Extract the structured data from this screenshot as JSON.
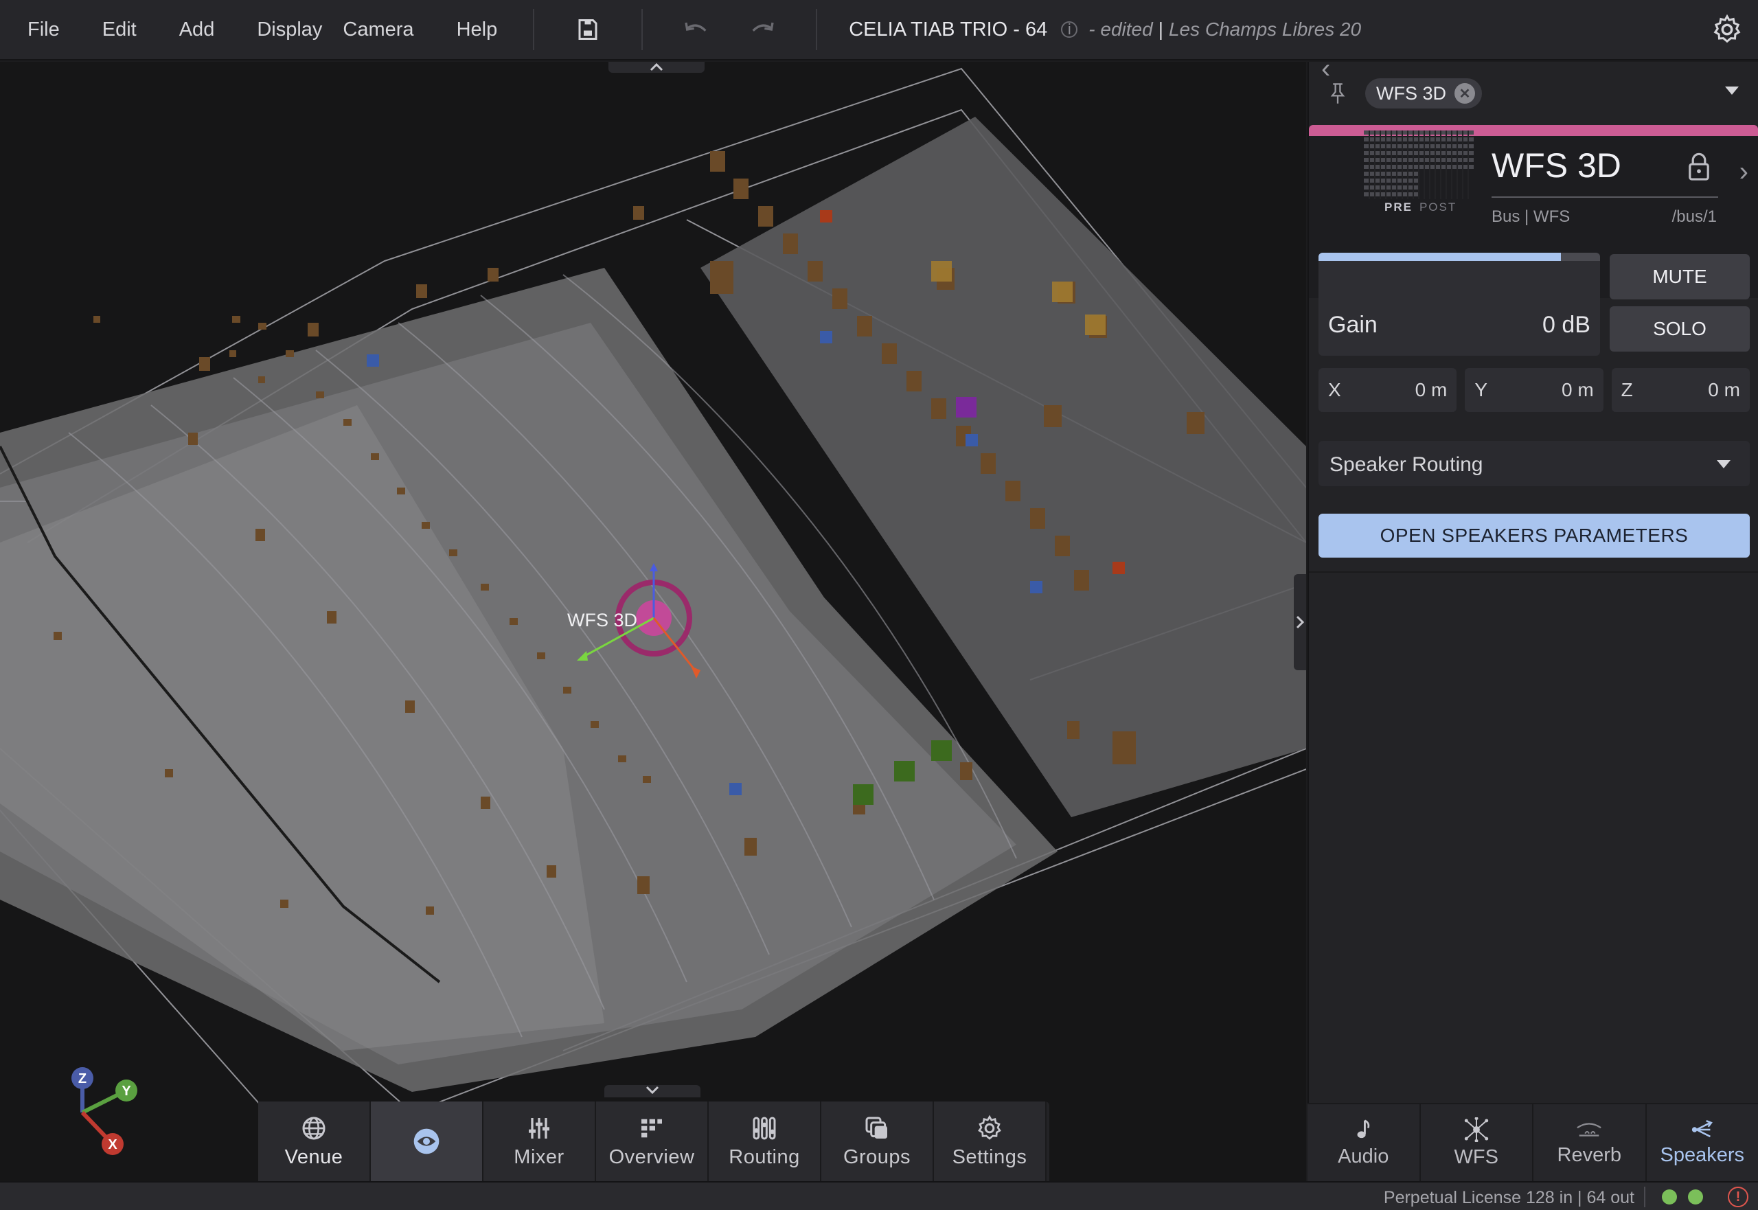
{
  "menu": {
    "file": "File",
    "edit": "Edit",
    "add": "Add",
    "display": "Display",
    "camera": "Camera",
    "help": "Help"
  },
  "toolbar": {
    "save_icon": "save-icon",
    "undo_icon": "undo-icon",
    "redo_icon": "redo-icon",
    "settings_icon": "gear-icon"
  },
  "document": {
    "title": "CELIA TIAB TRIO - 64",
    "info_glyph": "i",
    "edited": "- edited",
    "separator": "|",
    "venue": "Les Champs Libres 20"
  },
  "viewport": {
    "selected_object_label": "WFS 3D",
    "axis_labels": {
      "z": "Z",
      "y": "Y",
      "x": "X"
    }
  },
  "dock": {
    "items": [
      {
        "label": "Venue",
        "icon": "globe-icon"
      },
      {
        "label": "",
        "icon": "eye-icon",
        "active": true
      },
      {
        "label": "Mixer",
        "icon": "mixer-icon"
      },
      {
        "label": "Overview",
        "icon": "overview-icon"
      },
      {
        "label": "Routing",
        "icon": "routing-icon"
      },
      {
        "label": "Groups",
        "icon": "groups-icon"
      },
      {
        "label": "Settings",
        "icon": "gear-icon"
      }
    ]
  },
  "panel": {
    "chip_label": "WFS 3D",
    "accent_color": "#cc5c94",
    "track": {
      "name": "WFS 3D",
      "pre": "PRE",
      "post": "POST",
      "meta": "Bus | WFS",
      "path": "/bus/1"
    },
    "gain": {
      "label": "Gain",
      "value": "0 dB",
      "level": 0.86
    },
    "mute_label": "MUTE",
    "solo_label": "SOLO",
    "position": {
      "x_label": "X",
      "x_value": "0 m",
      "y_label": "Y",
      "y_value": "0 m",
      "z_label": "Z",
      "z_value": "0 m"
    },
    "routing_select": "Speaker Routing",
    "open_button": "OPEN SPEAKERS PARAMETERS",
    "tabs": [
      {
        "label": "Audio",
        "icon": "note-icon"
      },
      {
        "label": "WFS",
        "icon": "wfs-icon"
      },
      {
        "label": "Reverb",
        "icon": "reverb-icon"
      },
      {
        "label": "Speakers",
        "icon": "speakers-icon",
        "active": true
      }
    ]
  },
  "status": {
    "license": "Perpetual License 128 in | 64 out",
    "indicator_color": "#7bbf5a",
    "warn_glyph": "!",
    "warn_color": "#e0564e"
  }
}
